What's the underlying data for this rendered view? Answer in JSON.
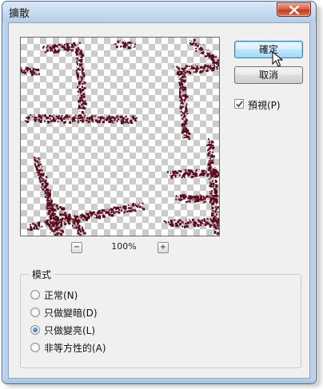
{
  "window": {
    "title": "擴散",
    "close_icon": "close-icon"
  },
  "buttons": {
    "ok_label": "確定",
    "cancel_label": "取消"
  },
  "preview": {
    "zoom_value": "100%",
    "zoom_out_label": "−",
    "zoom_in_label": "+",
    "ink_color": "#5a0d1f"
  },
  "preview_checkbox": {
    "label": "預視(P)",
    "checked": true
  },
  "mode_group": {
    "legend": "模式",
    "options": [
      {
        "label": "正常(N)",
        "selected": false
      },
      {
        "label": "只做變暗(D)",
        "selected": false
      },
      {
        "label": "只做變亮(L)",
        "selected": true
      },
      {
        "label": "非等方性的(A)",
        "selected": false
      }
    ]
  }
}
